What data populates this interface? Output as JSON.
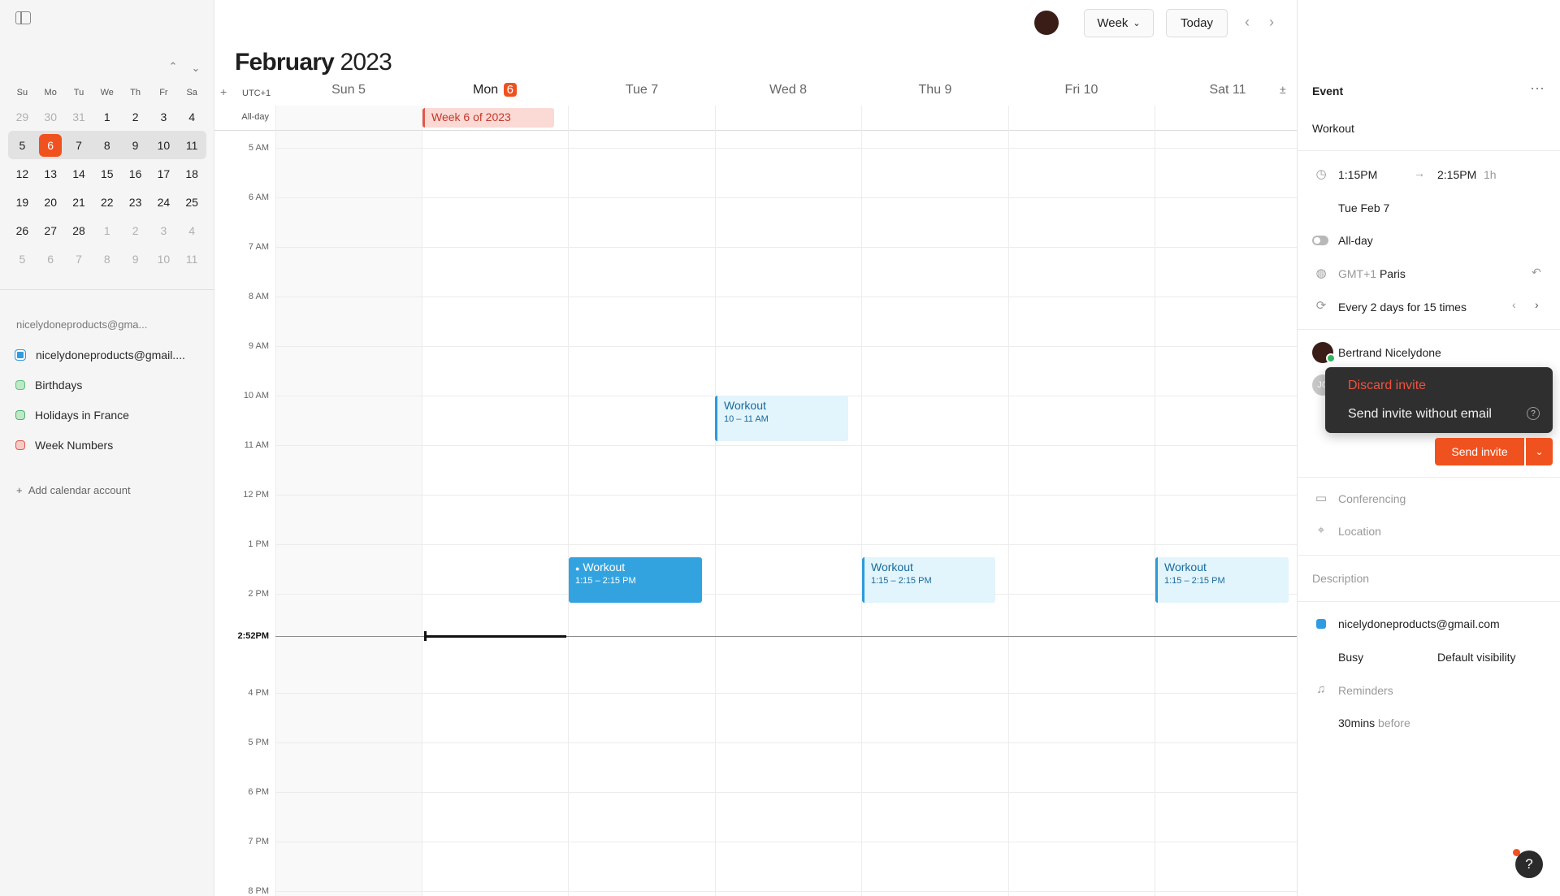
{
  "header": {
    "month": "February",
    "year": "2023",
    "view_label": "Week",
    "today_label": "Today"
  },
  "sidebar": {
    "weekday_labels": [
      "Su",
      "Mo",
      "Tu",
      "We",
      "Th",
      "Fr",
      "Sa"
    ],
    "weeks": [
      [
        "29",
        "30",
        "31",
        "1",
        "2",
        "3",
        "4"
      ],
      [
        "5",
        "6",
        "7",
        "8",
        "9",
        "10",
        "11"
      ],
      [
        "12",
        "13",
        "14",
        "15",
        "16",
        "17",
        "18"
      ],
      [
        "19",
        "20",
        "21",
        "22",
        "23",
        "24",
        "25"
      ],
      [
        "26",
        "27",
        "28",
        "1",
        "2",
        "3",
        "4"
      ],
      [
        "5",
        "6",
        "7",
        "8",
        "9",
        "10",
        "11"
      ]
    ],
    "account_label": "nicelydoneproducts@gma...",
    "calendars": [
      {
        "name": "nicelydoneproducts@gmail....",
        "color": "#2f9be0"
      },
      {
        "name": "Birthdays",
        "color": "#5cc07a"
      },
      {
        "name": "Holidays in France",
        "color": "#4db06a"
      },
      {
        "name": "Week Numbers",
        "color": "#e0584a"
      }
    ],
    "add_account_label": "Add calendar account"
  },
  "week": {
    "timezone": "UTC+1",
    "allday_label": "All-day",
    "days": [
      {
        "label": "Sun 5"
      },
      {
        "label": "Mon",
        "badge": "6"
      },
      {
        "label": "Tue 7"
      },
      {
        "label": "Wed 8"
      },
      {
        "label": "Thu 9"
      },
      {
        "label": "Fri 10"
      },
      {
        "label": "Sat 11"
      }
    ],
    "hours": [
      "5 AM",
      "6 AM",
      "7 AM",
      "8 AM",
      "9 AM",
      "10 AM",
      "11 AM",
      "12 PM",
      "1 PM",
      "2 PM",
      "4 PM",
      "5 PM",
      "6 PM",
      "7 PM",
      "8 PM"
    ],
    "now_label": "2:52PM",
    "week_chip": "Week 6 of 2023",
    "events": [
      {
        "title": "Workout",
        "time": "10 – 11 AM"
      },
      {
        "title": "Workout",
        "time": "1:15 – 2:15 PM"
      },
      {
        "title": "Workout",
        "time": "1:15 – 2:15 PM"
      },
      {
        "title": "Workout",
        "time": "1:15 – 2:15 PM"
      }
    ]
  },
  "panel": {
    "heading": "Event",
    "title": "Workout",
    "start_time": "1:15PM",
    "end_time": "2:15PM",
    "duration": "1h",
    "date": "Tue Feb 7",
    "allday_label": "All-day",
    "tz_offset": "GMT+1",
    "tz_city": "Paris",
    "recurrence": "Every 2 days for 15 times",
    "attendee_name": "Bertrand Nicelydone",
    "attendee2_initials": "JC",
    "menu": {
      "discard": "Discard invite",
      "send_without_email": "Send invite without email"
    },
    "send_label": "Send invite",
    "conferencing": "Conferencing",
    "location": "Location",
    "description": "Description",
    "calendar_email": "nicelydoneproducts@gmail.com",
    "busy": "Busy",
    "visibility": "Default visibility",
    "reminders": "Reminders",
    "reminder_value": "30mins",
    "reminder_suffix": "before"
  }
}
